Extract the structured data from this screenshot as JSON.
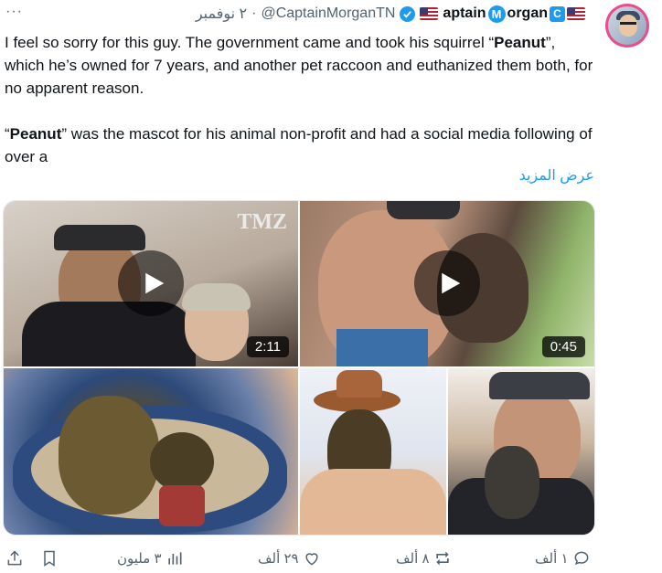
{
  "header": {
    "more": "···",
    "date": "٢ نوفمبر",
    "separator": "·",
    "handle": "@CaptainMorganTN",
    "display_name_part1": "aptain",
    "display_name_badge": "M",
    "display_name_part2": "organ",
    "badge_letter": "C"
  },
  "post": {
    "para1_before": "I feel so sorry for this guy. The government came and took his squirrel “",
    "para1_bold": "Peanut",
    "para1_after": "”, which he’s owned for 7 years, and another pet raccoon and euthanized them both, for no apparent reason.",
    "para2_before": "“",
    "para2_bold": "Peanut",
    "para2_after": "” was the mascot for his animal non-profit and had a social media following of over a",
    "show_more": "عرض المزيد"
  },
  "media": {
    "video1": {
      "duration": "2:11",
      "watermark": "TMZ"
    },
    "video2": {
      "duration": "0:45"
    }
  },
  "actions": {
    "replies": "١ ألف",
    "reposts": "٨ ألف",
    "likes": "٢٩ ألف",
    "views": "٣ مليون"
  },
  "colors": {
    "accent": "#1d9bf0",
    "secondary_text": "#536471",
    "avatar_ring": "#e94e8c"
  },
  "icons": [
    "more-icon",
    "verified-icon",
    "us-flag-icon",
    "avatar",
    "play-icon",
    "reply-icon",
    "repost-icon",
    "like-icon",
    "views-icon",
    "bookmark-icon",
    "share-icon"
  ]
}
